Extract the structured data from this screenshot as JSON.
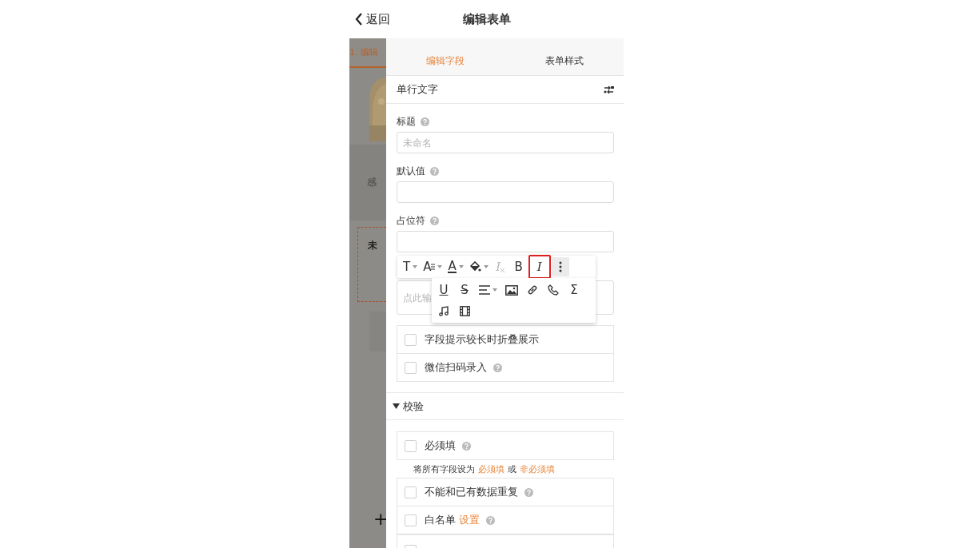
{
  "header": {
    "back": "返回",
    "title": "编辑表单"
  },
  "backdrop": {
    "step_tab": "1. 编辑",
    "text": "感",
    "field_title": "未",
    "add": "+"
  },
  "tabs": [
    {
      "label": "编辑字段",
      "selected": true
    },
    {
      "label": "表单样式",
      "selected": false
    }
  ],
  "field_type": "单行文字",
  "fields": [
    {
      "label": "标题",
      "help": true,
      "placeholder": "未命名"
    },
    {
      "label": "默认值",
      "help": true
    },
    {
      "label": "占位符",
      "help": true
    }
  ],
  "description": {
    "placeholder": "点此输"
  },
  "toolbar": {
    "row_1": [
      {
        "kind": "glyph",
        "glyph": "T",
        "selected": false,
        "disabled": false
      },
      {
        "kind": "glyph",
        "glyph": "A",
        "selected": false,
        "disabled": false
      },
      {
        "kind": "glyph",
        "glyph": "A",
        "selected": false,
        "disabled": false
      },
      {
        "kind": "icon",
        "selected": false,
        "disabled": false
      },
      {
        "kind": "glyph",
        "glyph": "I",
        "selected": false,
        "disabled": true
      },
      {
        "kind": "glyph",
        "glyph": "B",
        "selected": false,
        "disabled": false
      },
      {
        "kind": "glyph",
        "glyph": "I",
        "selected": true,
        "disabled": false
      },
      {
        "kind": "icon",
        "selected": false,
        "disabled": false
      }
    ],
    "row_2": [
      {
        "kind": "glyph",
        "glyph": "U",
        "selected": false,
        "disabled": false
      },
      {
        "kind": "glyph",
        "glyph": "S",
        "selected": false,
        "disabled": false
      },
      {
        "kind": "icon",
        "selected": false,
        "disabled": false
      },
      {
        "kind": "icon",
        "selected": false,
        "disabled": false
      },
      {
        "kind": "icon",
        "selected": false,
        "disabled": false
      },
      {
        "kind": "icon",
        "selected": false,
        "disabled": false
      },
      {
        "kind": "glyph",
        "glyph": "Σ",
        "selected": false,
        "disabled": false
      },
      {
        "kind": "icon",
        "selected": false,
        "disabled": false
      },
      {
        "kind": "icon",
        "selected": false,
        "disabled": false
      }
    ]
  },
  "options": [
    {
      "label": "字段提示较长时折叠展示",
      "checked": false,
      "help": false
    },
    {
      "label": "微信扫码录入",
      "checked": false,
      "help": true
    }
  ],
  "validation": {
    "title": "校验",
    "expanded": true,
    "required": {
      "label": "必须填",
      "checked": false,
      "help": true
    },
    "bulk_hint": {
      "prefix": "将所有字段设为",
      "link_1": "必须填",
      "middle": "或",
      "link_2": "非必须填"
    },
    "rules": [
      {
        "label": "不能和已有数据重复",
        "checked": false,
        "help": true
      },
      {
        "label": "白名单",
        "link": "设置",
        "checked": false,
        "help": true
      }
    ]
  }
}
